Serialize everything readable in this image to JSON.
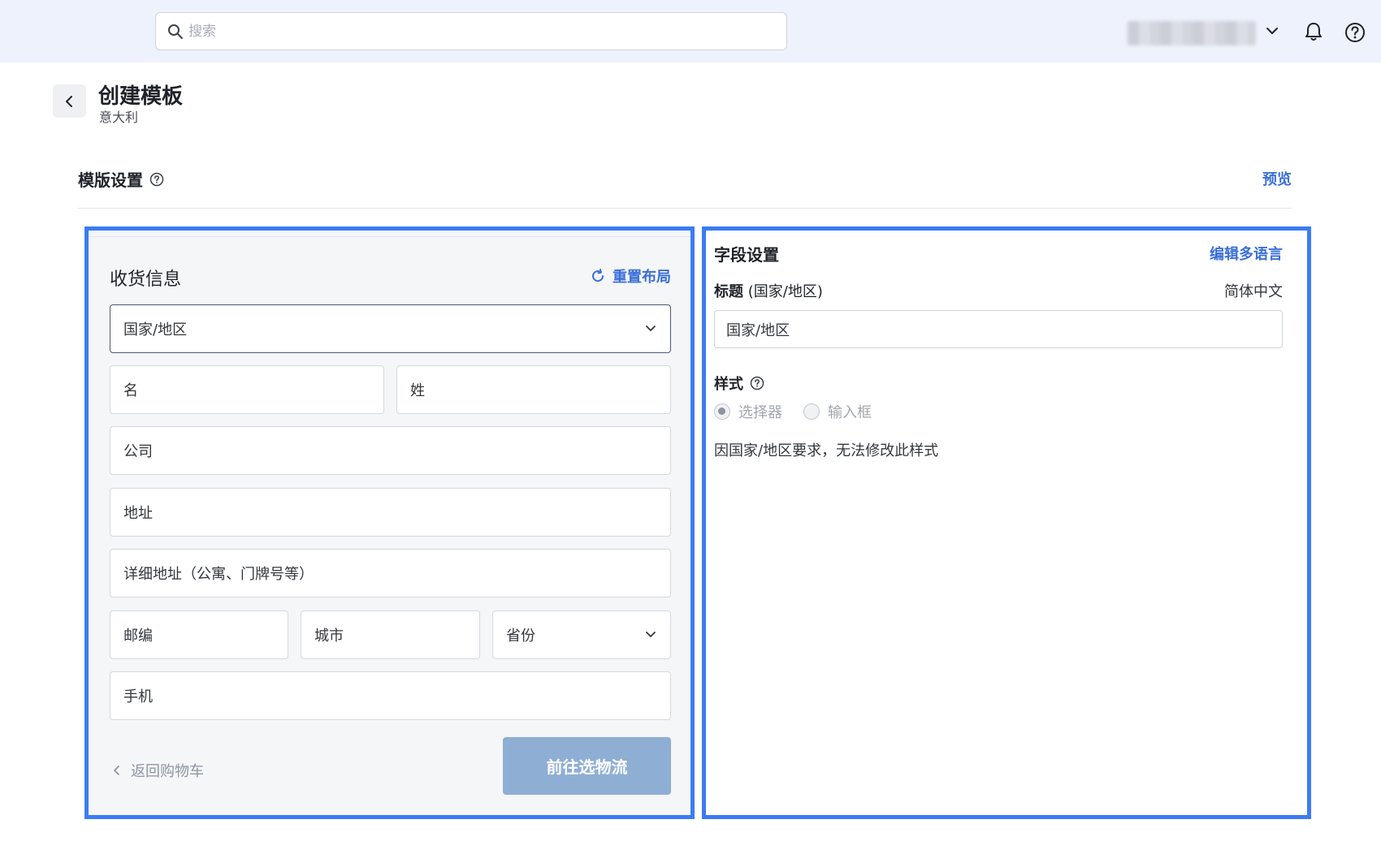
{
  "topbar": {
    "search_placeholder": "搜索"
  },
  "header": {
    "title": "创建模板",
    "subtitle": "意大利"
  },
  "section": {
    "title": "模版设置",
    "preview_label": "预览"
  },
  "form": {
    "title": "收货信息",
    "reset_label": "重置布局",
    "country": "国家/地区",
    "first_name": "名",
    "last_name": "姓",
    "company": "公司",
    "address": "地址",
    "address_detail": "详细地址（公寓、门牌号等）",
    "postcode": "邮编",
    "city": "城市",
    "province": "省份",
    "phone": "手机",
    "back_label": "返回购物车",
    "next_label": "前往选物流"
  },
  "field_settings": {
    "title": "字段设置",
    "edit_lang_label": "编辑多语言",
    "label_prefix": "标题",
    "label_suffix": "(国家/地区)",
    "language": "简体中文",
    "title_value": "国家/地区",
    "style_label": "样式",
    "style_options": [
      "选择器",
      "输入框"
    ],
    "selected_style": "选择器",
    "note": "因国家/地区要求，无法修改此样式"
  },
  "colors": {
    "accent": "#3a6fd8",
    "highlight_border": "#3b7bf5",
    "disabled_button": "#8eaed4",
    "topbar_bg": "#eef2fc"
  }
}
